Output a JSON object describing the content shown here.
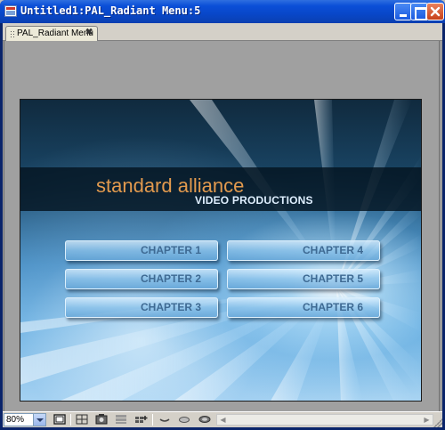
{
  "window": {
    "title": "Untitled1:PAL_Radiant Menu:5",
    "minimize_icon": "minimize-icon",
    "maximize_icon": "maximize-icon",
    "close_icon": "close-icon"
  },
  "tabs": [
    {
      "label": "PAL_Radiant Menu",
      "close_symbol": "✖",
      "active": true
    }
  ],
  "menu": {
    "brand": "standard alliance",
    "subbrand": "VIDEO PRODUCTIONS",
    "chapters": [
      {
        "label": "CHAPTER 1"
      },
      {
        "label": "CHAPTER 2"
      },
      {
        "label": "CHAPTER 3"
      },
      {
        "label": "CHAPTER 4"
      },
      {
        "label": "CHAPTER 5"
      },
      {
        "label": "CHAPTER 6"
      }
    ],
    "colors": {
      "brand": "#e29a4e",
      "subbrand": "#dfefff",
      "button_text": "#3e6a93"
    }
  },
  "statusbar": {
    "zoom": "80%",
    "tools": [
      "single-page-view-icon",
      "safe-area-icon",
      "preview-icon",
      "grid-icon",
      "add-button-icon",
      "link-icon",
      "ellipse-icon",
      "fill-icon"
    ],
    "scroll_left": "◀",
    "scroll_right": "▶"
  }
}
